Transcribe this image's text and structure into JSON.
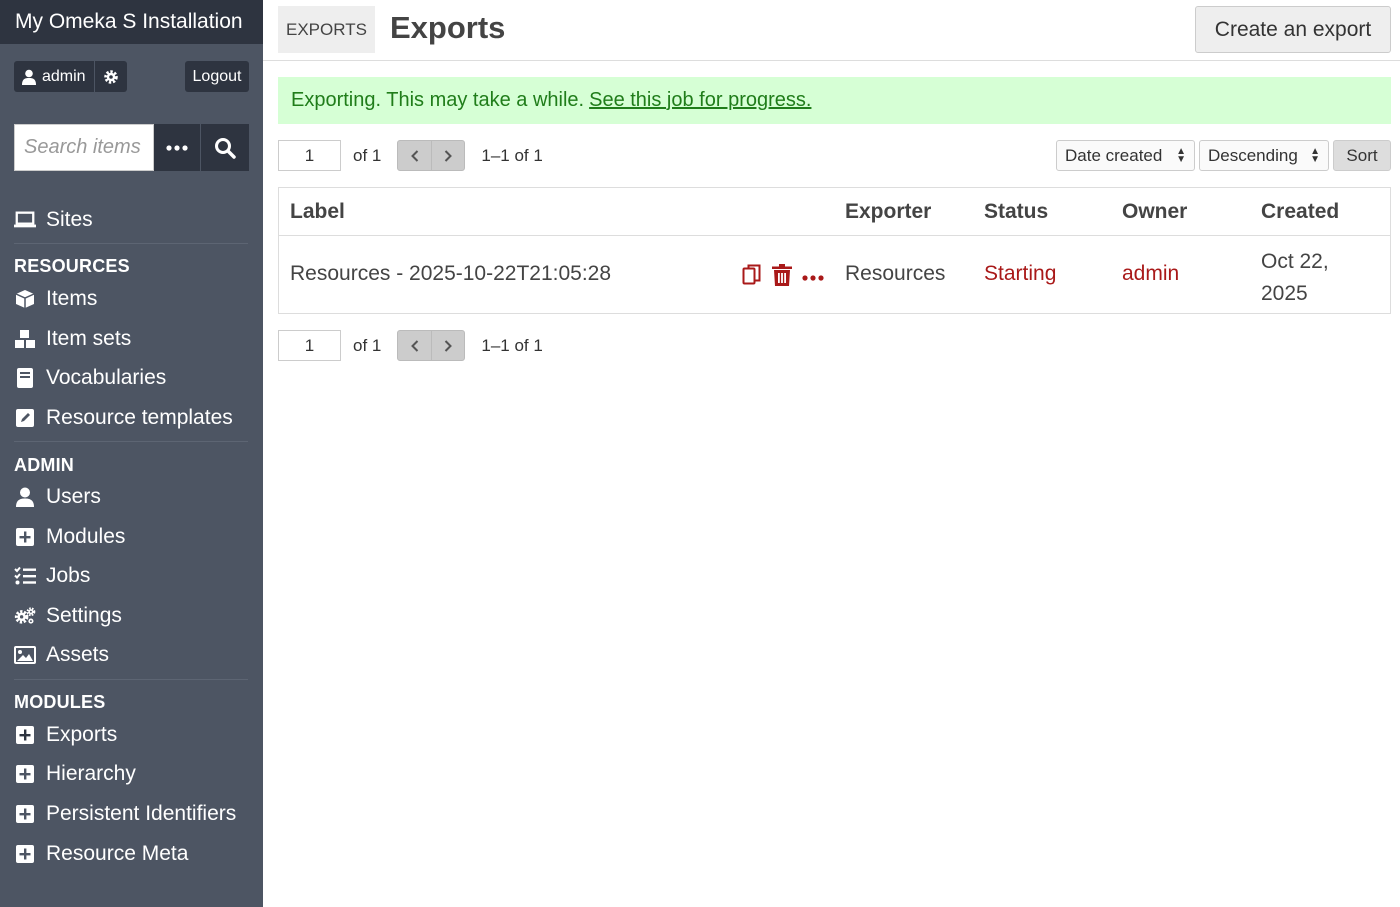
{
  "sidebar": {
    "installation_title": "My Omeka S Installation",
    "user_name": "admin",
    "logout_label": "Logout",
    "search_placeholder": "Search items",
    "sites_label": "Sites",
    "resources_heading": "RESOURCES",
    "resources": [
      "Items",
      "Item sets",
      "Vocabularies",
      "Resource templates"
    ],
    "admin_heading": "ADMIN",
    "admin": [
      "Users",
      "Modules",
      "Jobs",
      "Settings",
      "Assets"
    ],
    "modules_heading": "MODULES",
    "modules": [
      "Exports",
      "Hierarchy",
      "Persistent Identifiers",
      "Resource Meta"
    ]
  },
  "header": {
    "section_label": "EXPORTS",
    "title": "Exports",
    "create_button": "Create an export"
  },
  "flash": {
    "message": "Exporting. This may take a while.",
    "link_text": "See this job for progress."
  },
  "pagination": {
    "page": "1",
    "of": "of 1",
    "range": "1–1 of 1"
  },
  "sort": {
    "by": "Date created",
    "order": "Descending",
    "button": "Sort"
  },
  "table": {
    "headers": [
      "Label",
      "Exporter",
      "Status",
      "Owner",
      "Created"
    ],
    "rows": [
      {
        "label": "Resources - 2025-10-22T21:05:28",
        "exporter": "Resources",
        "status": "Starting",
        "owner": "admin",
        "created_line1": "Oct 22,",
        "created_line2": "2025"
      }
    ]
  },
  "colors": {
    "sidebar_bg": "#4d5563",
    "sidebar_dark": "#2e3440",
    "link_red": "#a91919",
    "success_bg": "#d6ffd5",
    "success_text": "#207d1a"
  }
}
